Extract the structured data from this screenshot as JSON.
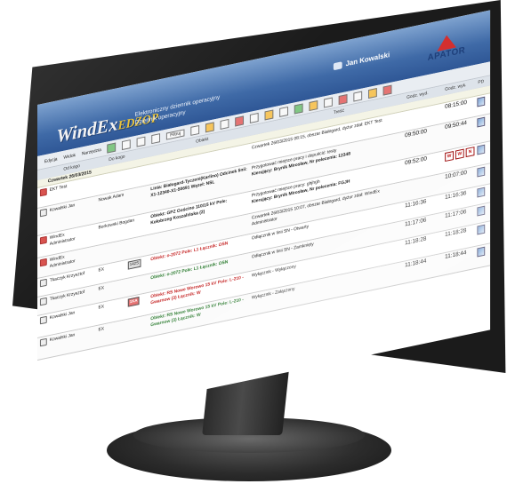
{
  "header": {
    "logo_main": "WindEx",
    "logo_sub": "EDZOP",
    "app_title_line1": "Elektroniczny dziennik operacyjny",
    "app_title_line2": "Dziennik operacyjny",
    "user_name": "Jan Kowalski",
    "brand": "APATOR"
  },
  "menu": {
    "items": [
      "Edycja",
      "Widok",
      "Narzędzia"
    ],
    "filter_label": "Filtruj"
  },
  "columns": {
    "od_kogo": "Od kogo",
    "do_kogo": "Do kogo",
    "obiekt": "Obiekt",
    "tresc": "Treść",
    "godz_wyd": "Godz. wyd.",
    "godz_wyk": "Godz. wyk.",
    "pd": "PD"
  },
  "date_header": "Czwartek 26/03/2015",
  "rows": [
    {
      "from": "EKT Test",
      "to": "",
      "object": "",
      "content": "Czwartek 26/03/2015 08:15, obszar Białogard, dyżur zdał: EKT Test",
      "time_issued": "",
      "time_done": "08:15:00"
    },
    {
      "from": "Kowalski Jan",
      "to": "Nowak Adam",
      "object": "Linia: Białogard-Tyczeni(Karlino) Odcinek linii: X1-12340-X1-50691 Węzeł: NSL",
      "content_1": "Przygotować miejsce pracy i dopuścić: testy",
      "content_2": "Kierujący: Brynik Mirosław, Nr polecenia: 12348",
      "time_issued": "09:50:00",
      "time_done": "09:50:44"
    },
    {
      "from": "WindEx Administrator",
      "to": "Borkowski Bogdan",
      "object": "Obiekt: GPZ Gościno 110/15 kV Pole: Kołobrzeg Koszalińska (2)",
      "content_1": "Przygotować miejsce pracy: ghjhgh",
      "content_2": "Kierujący: Brynik Mirosław, Nr polecenia: FGJH",
      "time_issued": "09:52:00",
      "time_done": "",
      "badges": [
        "W",
        "W",
        "N"
      ]
    },
    {
      "from": "WindEx Administrator",
      "to": "",
      "object": "",
      "content": "Czwartek 26/03/2015 10:07, obszar Białogard, dyżur zdał: WindEx Administrator",
      "time_issued": "",
      "time_done": "10:07:00"
    },
    {
      "from": "Tkaczyk Krzysztof",
      "to": "EX",
      "tag": "142S",
      "object": "Obiekt: o-2072 Pole: L1 Łącznik: OSN",
      "content": "Odłącznik w linii SN - Otwarty",
      "time_issued": "11:16:36",
      "time_done": "11:16:36"
    },
    {
      "from": "Tkaczyk Krzysztof",
      "to": "EX",
      "object": "Obiekt: o-2072 Pole: L1 Łącznik: OSN",
      "content": "Odłącznik w linii SN - Zamknięty",
      "time_issued": "11:17:06",
      "time_done": "11:17:06"
    },
    {
      "from": "Kowalski Jan",
      "to": "EX",
      "tag": "1KA",
      "object": "Obiekt: RS Nowe Worowo 15 kV Pole: L-210 - Gwarnow (3) Łącznik: W",
      "content": "Wyłącznik - Wyłączony",
      "time_issued": "11:18:28",
      "time_done": "11:18:28"
    },
    {
      "from": "Kowalski Jan",
      "to": "EX",
      "object": "Obiekt: RS Nowe Worowo 15 kV Pole: L-210 - Gwarnow (3) Łącznik: W",
      "content": "Wyłącznik - Załączony",
      "time_issued": "11:18:44",
      "time_done": "11:18:44"
    }
  ],
  "colors": {
    "header_blue": "#3f6aa7",
    "brand_red": "#d32f2f",
    "alert_red": "#c62828",
    "ok_green": "#2e7d32"
  }
}
